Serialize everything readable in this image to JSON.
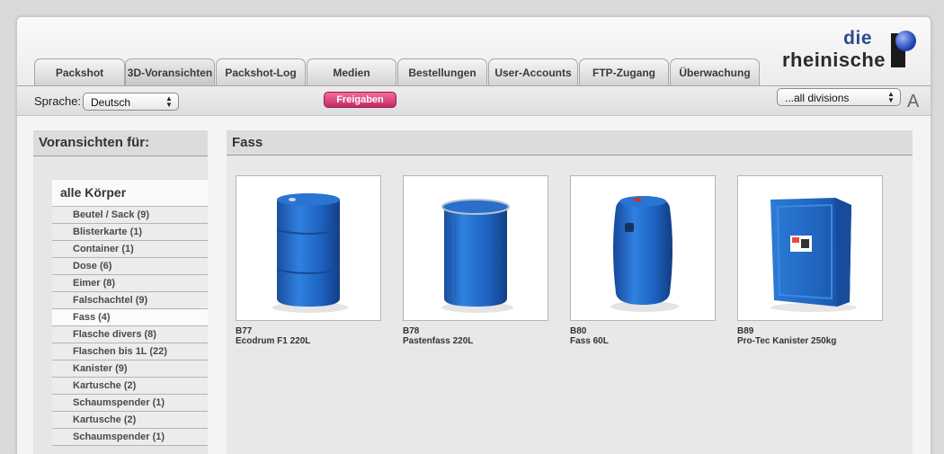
{
  "tabs": [
    {
      "label": "Packshot"
    },
    {
      "label": "3D-Voransichten",
      "active": true
    },
    {
      "label": "Packshot-Log"
    },
    {
      "label": "Medien"
    },
    {
      "label": "Bestellungen"
    },
    {
      "label": "User-Accounts"
    },
    {
      "label": "FTP-Zugang"
    },
    {
      "label": "Überwachung"
    }
  ],
  "logo": {
    "line1": "die",
    "line2": "rheinische"
  },
  "toolbar": {
    "language_label": "Sprache:",
    "language_value": "Deutsch",
    "release_button": "Freigaben",
    "division_value": "...all divisions",
    "font_size_button": "A"
  },
  "sidebar": {
    "title": "Voransichten für:",
    "all_label": "alle Körper",
    "items": [
      "Beutel / Sack (9)",
      "Blisterkarte (1)",
      "Container (1)",
      "Dose (6)",
      "Eimer (8)",
      "Falschachtel (9)",
      "Fass (4)",
      "Flasche divers (8)",
      "Flaschen bis 1L (22)",
      "Kanister (9)",
      "Kartusche (2)",
      "Schaumspender (1)",
      "Kartusche (2)",
      "Schaumspender (1)"
    ],
    "active_item": "Fass (4)"
  },
  "main": {
    "title": "Fass",
    "products": [
      {
        "code": "B77",
        "name": "Ecodrum F1 220L",
        "image": "blue-plastic-drum"
      },
      {
        "code": "B78",
        "name": "Pastenfass 220L",
        "image": "blue-open-drum"
      },
      {
        "code": "B80",
        "name": "Fass 60L",
        "image": "blue-small-drum"
      },
      {
        "code": "B89",
        "name": "Pro-Tec Kanister 250kg",
        "image": "blue-ibc-container"
      }
    ]
  },
  "colors": {
    "accent": "#c22a64",
    "logo_blue": "#2e4a8c",
    "product_blue": "#1f6bc4"
  }
}
